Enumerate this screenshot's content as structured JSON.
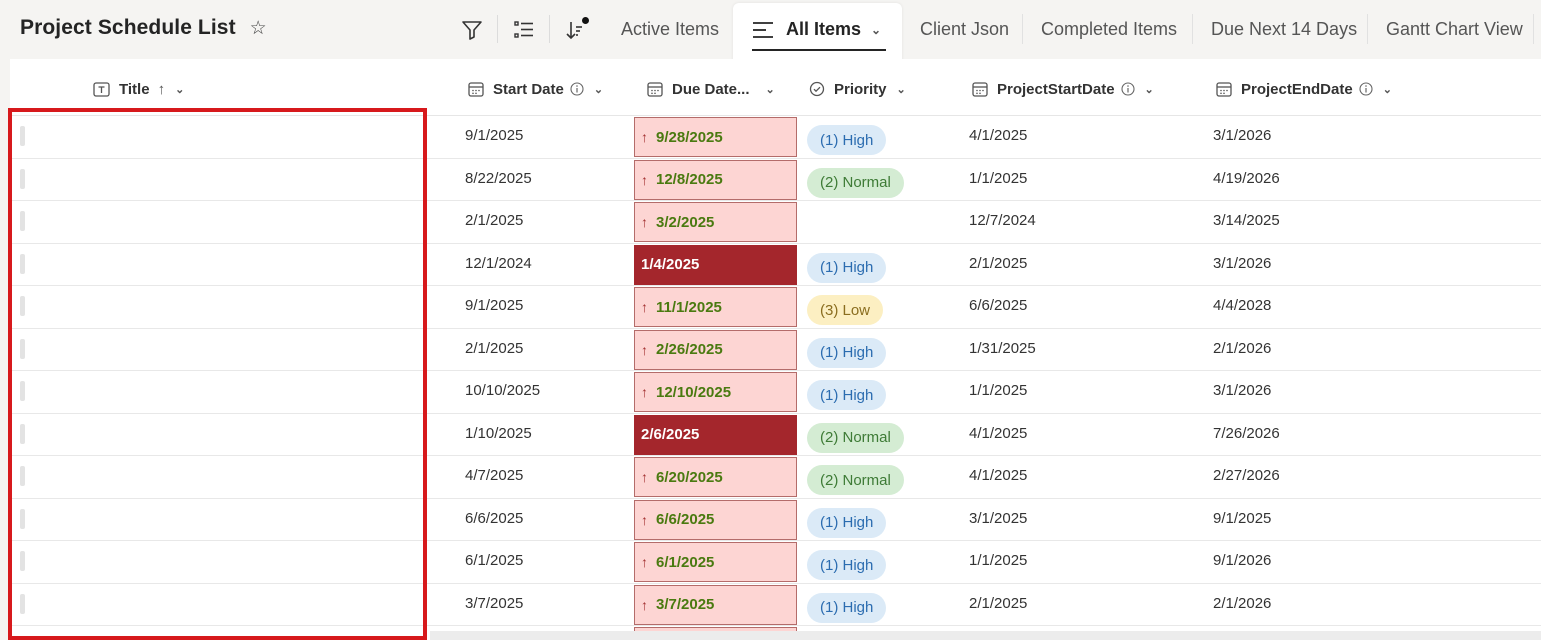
{
  "app": {
    "title": "Project Schedule List",
    "favorite_icon": "star-icon"
  },
  "toolbar": {
    "filter_icon": "filter-icon",
    "group_icon": "group-by-icon",
    "sort_icon": "sort-icon"
  },
  "views": [
    {
      "label": "Active Items"
    },
    {
      "label": "All Items"
    },
    {
      "label": "Client Json"
    },
    {
      "label": "Completed Items"
    },
    {
      "label": "Due Next 14 Days"
    },
    {
      "label": "Gantt Chart View"
    }
  ],
  "active_view": "All Items",
  "columns": {
    "title": "Title",
    "start": "Start Date",
    "due": "Due Date...",
    "priority": "Priority",
    "pstart": "ProjectStartDate",
    "pend": "ProjectEndDate"
  },
  "rows": [
    {
      "title": "",
      "start": "9/1/2025",
      "due": "9/28/2025",
      "overdue": false,
      "priority": "(1) High",
      "pstart": "4/1/2025",
      "pend": "3/1/2026"
    },
    {
      "title": "",
      "start": "8/22/2025",
      "due": "12/8/2025",
      "overdue": false,
      "priority": "(2) Normal",
      "pstart": "1/1/2025",
      "pend": "4/19/2026"
    },
    {
      "title": "",
      "start": "2/1/2025",
      "due": "3/2/2025",
      "overdue": false,
      "priority": "",
      "pstart": "12/7/2024",
      "pend": "3/14/2025"
    },
    {
      "title": "",
      "start": "12/1/2024",
      "due": "1/4/2025",
      "overdue": true,
      "priority": "(1) High",
      "pstart": "2/1/2025",
      "pend": "3/1/2026"
    },
    {
      "title": "",
      "start": "9/1/2025",
      "due": "11/1/2025",
      "overdue": false,
      "priority": "(3) Low",
      "pstart": "6/6/2025",
      "pend": "4/4/2028"
    },
    {
      "title": "",
      "start": "2/1/2025",
      "due": "2/26/2025",
      "overdue": false,
      "priority": "(1) High",
      "pstart": "1/31/2025",
      "pend": "2/1/2026"
    },
    {
      "title": "",
      "start": "10/10/2025",
      "due": "12/10/2025",
      "overdue": false,
      "priority": "(1) High",
      "pstart": "1/1/2025",
      "pend": "3/1/2026"
    },
    {
      "title": "",
      "start": "1/10/2025",
      "due": "2/6/2025",
      "overdue": true,
      "priority": "(2) Normal",
      "pstart": "4/1/2025",
      "pend": "7/26/2026"
    },
    {
      "title": "",
      "start": "4/7/2025",
      "due": "6/20/2025",
      "overdue": false,
      "priority": "(2) Normal",
      "pstart": "4/1/2025",
      "pend": "2/27/2026"
    },
    {
      "title": "",
      "start": "6/6/2025",
      "due": "6/6/2025",
      "overdue": false,
      "priority": "(1) High",
      "pstart": "3/1/2025",
      "pend": "9/1/2025"
    },
    {
      "title": "",
      "start": "6/1/2025",
      "due": "6/1/2025",
      "overdue": false,
      "priority": "(1) High",
      "pstart": "1/1/2025",
      "pend": "9/1/2026"
    },
    {
      "title": "",
      "start": "3/7/2025",
      "due": "3/7/2025",
      "overdue": false,
      "priority": "(1) High",
      "pstart": "2/1/2025",
      "pend": "2/1/2026"
    }
  ],
  "colors": {
    "high_bg": "#dbeaf7",
    "high_fg": "#2b6cb0",
    "normal_bg": "#d4ecd3",
    "normal_fg": "#3e7b36",
    "low_bg": "#fcefc2",
    "low_fg": "#8a6d1f",
    "due_bg": "#fdd5d3",
    "overdue_bg": "#a4262c",
    "highlight_box": "#d7191c"
  }
}
